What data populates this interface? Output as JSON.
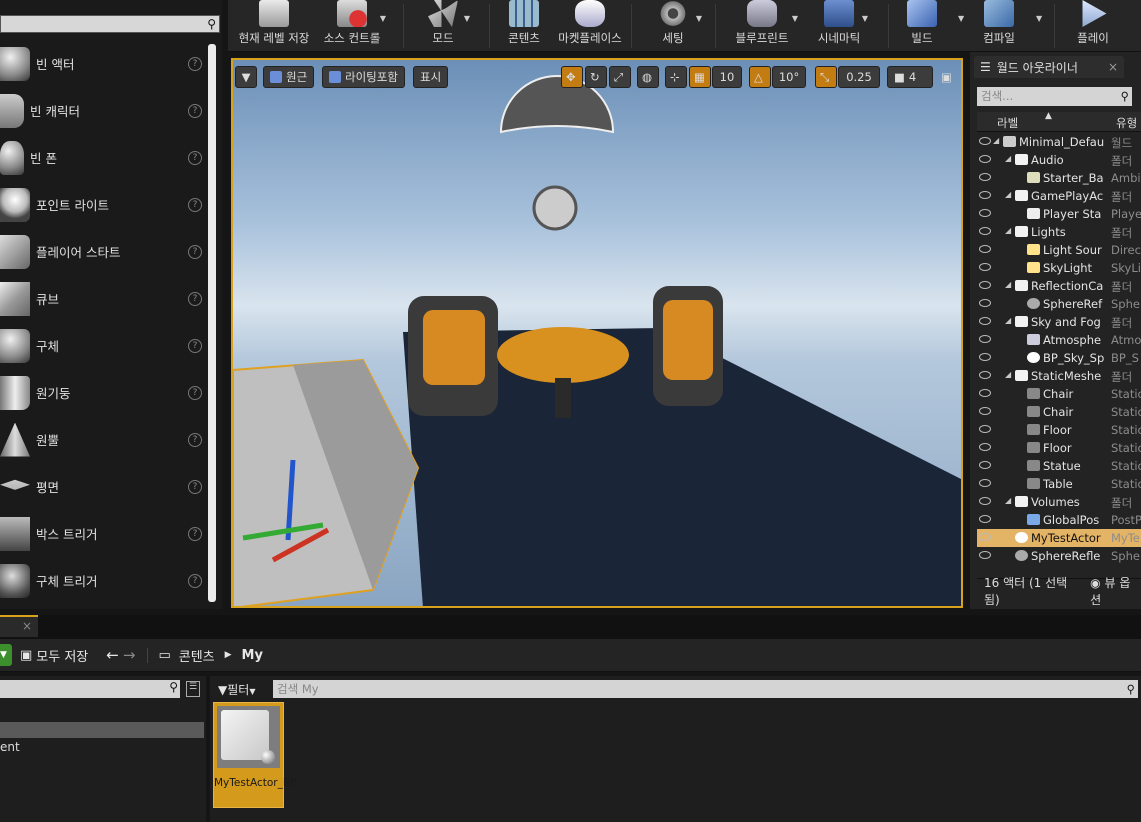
{
  "left_panel": {
    "items": [
      {
        "label": "빈 액터"
      },
      {
        "label": "빈 캐릭터"
      },
      {
        "label": "빈 폰"
      },
      {
        "label": "포인트 라이트"
      },
      {
        "label": "플레이어 스타트"
      },
      {
        "label": "큐브"
      },
      {
        "label": "구체"
      },
      {
        "label": "원기둥"
      },
      {
        "label": "원뿔"
      },
      {
        "label": "평면"
      },
      {
        "label": "박스 트리거"
      },
      {
        "label": "구체 트리거"
      }
    ]
  },
  "toolbar": {
    "buttons": [
      {
        "label": "현재 레벨 저장"
      },
      {
        "label": "소스 컨트롤"
      },
      {
        "label": "모드"
      },
      {
        "label": "콘텐츠"
      },
      {
        "label": "마켓플레이스"
      },
      {
        "label": "세팅"
      },
      {
        "label": "블루프린트"
      },
      {
        "label": "시네마틱"
      },
      {
        "label": "빌드"
      },
      {
        "label": "컴파일"
      },
      {
        "label": "플레이"
      }
    ]
  },
  "viewport": {
    "perspective_label": "원근",
    "lighting_label": "라이팅포함",
    "show_label": "표시",
    "grid_snap": "10",
    "rotation_snap": "10°",
    "scale_snap": "0.25",
    "camera_speed": "4"
  },
  "outliner": {
    "tab_title": "월드 아웃라이너",
    "search_placeholder": "검색...",
    "col_label": "라벨",
    "col_type": "유형",
    "rows": [
      {
        "name": "Minimal_Defau",
        "type": "월드",
        "depth": 0,
        "kind": "world"
      },
      {
        "name": "Audio",
        "type": "폴더",
        "depth": 1,
        "kind": "folder"
      },
      {
        "name": "Starter_Ba",
        "type": "Ambie",
        "depth": 2,
        "kind": "sound"
      },
      {
        "name": "GamePlayAc",
        "type": "폴더",
        "depth": 1,
        "kind": "folder"
      },
      {
        "name": "Player Sta",
        "type": "Playe",
        "depth": 2,
        "kind": "player"
      },
      {
        "name": "Lights",
        "type": "폴더",
        "depth": 1,
        "kind": "folder"
      },
      {
        "name": "Light Sour",
        "type": "Direc",
        "depth": 2,
        "kind": "light"
      },
      {
        "name": "SkyLight",
        "type": "SkyLi",
        "depth": 2,
        "kind": "light"
      },
      {
        "name": "ReflectionCa",
        "type": "폴더",
        "depth": 1,
        "kind": "folder"
      },
      {
        "name": "SphereRef",
        "type": "Spher",
        "depth": 2,
        "kind": "sphere"
      },
      {
        "name": "Sky and Fog",
        "type": "폴더",
        "depth": 1,
        "kind": "folder"
      },
      {
        "name": "Atmosphe",
        "type": "Atmo",
        "depth": 2,
        "kind": "fog"
      },
      {
        "name": "BP_Sky_Sp",
        "type": "BP_S",
        "depth": 2,
        "kind": "ball"
      },
      {
        "name": "StaticMeshe",
        "type": "폴더",
        "depth": 1,
        "kind": "folder"
      },
      {
        "name": "Chair",
        "type": "Static",
        "depth": 2,
        "kind": "mesh"
      },
      {
        "name": "Chair",
        "type": "Static",
        "depth": 2,
        "kind": "mesh"
      },
      {
        "name": "Floor",
        "type": "Static",
        "depth": 2,
        "kind": "mesh"
      },
      {
        "name": "Floor",
        "type": "Static",
        "depth": 2,
        "kind": "mesh"
      },
      {
        "name": "Statue",
        "type": "Static",
        "depth": 2,
        "kind": "mesh"
      },
      {
        "name": "Table",
        "type": "Static",
        "depth": 2,
        "kind": "mesh"
      },
      {
        "name": "Volumes",
        "type": "폴더",
        "depth": 1,
        "kind": "folder"
      },
      {
        "name": "GlobalPos",
        "type": "PostP",
        "depth": 2,
        "kind": "volume"
      },
      {
        "name": "MyTestActor",
        "type": "MyTe",
        "depth": 1,
        "kind": "ball",
        "selected": true
      },
      {
        "name": "SphereRefle",
        "type": "Spher",
        "depth": 1,
        "kind": "sphere"
      }
    ],
    "status": "16 액터 (1 선택됨)",
    "view_options": "뷰 옵션"
  },
  "content_browser": {
    "save_all": "모두 저장",
    "path_root": "콘텐츠",
    "path_leaf": "My",
    "filter_label": "필터",
    "search_placeholder": "검색 My",
    "source_partial": "ent",
    "assets": [
      {
        "name": "MyTestActor_BP"
      }
    ]
  },
  "colors": {
    "accent": "#d8a21c",
    "selection": "#e4b466"
  }
}
